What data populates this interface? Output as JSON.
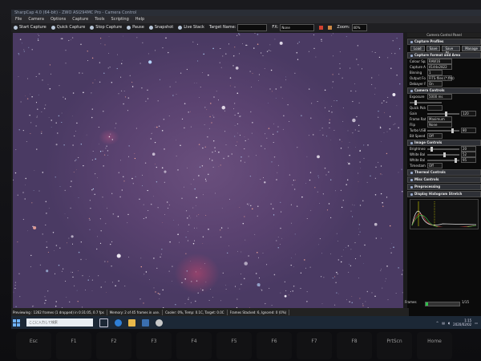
{
  "window": {
    "title": "SharpCap 4.0 (64-bit) - ZWO ASI294MC Pro - Camera Control"
  },
  "menu": [
    "File",
    "Camera",
    "Options",
    "Capture",
    "Tools",
    "Scripting",
    "Help"
  ],
  "toolbar": {
    "start_capture": "Start Capture",
    "quick_capture": "Quick Capture",
    "stop_capture": "Stop Capture",
    "pause": "Pause",
    "snapshot": "Snapshot",
    "live_stack": "Live Stack",
    "target_name_label": "Target Name:",
    "target_name_value": "",
    "fx_label": "FX:",
    "fx_value": "None",
    "zoom_label": "Zoom:",
    "zoom_value": "40%"
  },
  "panel": {
    "title": "Camera Control Panel",
    "capture_profiles": "Capture Profiles",
    "profile_buttons": [
      "Load",
      "Save",
      "Save As",
      "Manage"
    ],
    "capture_format": "Capture Format and Area",
    "colour_space_label": "Colour Space",
    "colour_space_value": "RAW16",
    "capture_area_label": "Capture Area",
    "capture_area_value": "4144x2822",
    "binning_label": "Binning",
    "binning_value": "1",
    "output_format_label": "Output Format",
    "output_format_value": "FITS files (*.fits)",
    "debayer_label": "Debayer Preview",
    "debayer_value": "On",
    "camera_controls": "Camera Controls",
    "exposure_label": "Exposure",
    "exposure_value": "5000 ms",
    "quick_picks_label": "Quick Picks",
    "gain_label": "Gain",
    "gain_value": "120",
    "frame_rate_label": "Frame Rate Limit",
    "frame_rate_value": "Maximum",
    "flip_label": "Flip",
    "flip_value": "None",
    "turbo_label": "Turbo USB",
    "turbo_value": "80",
    "bit_speed_label": "Bit Speed Mode",
    "bit_speed_value": "Off",
    "image_controls": "Image Controls",
    "brightness_label": "Brightness",
    "brightness_value": "20",
    "wb_red_label": "White Bal (R)",
    "wb_red_value": "52",
    "wb_blue_label": "White Bal (B)",
    "wb_blue_value": "95",
    "timestamp_label": "Timestamp Frames",
    "timestamp_value": "Off",
    "thermal": "Thermal Controls",
    "misc": "Misc Controls",
    "preprocessing": "Preprocessing",
    "histogram": "Display Histogram Stretch"
  },
  "status": {
    "previewing": "Previewing : 1262 frames (1 dropped) in 0:31:05, 0.7 fps",
    "memory": "Memory: 2 of 45 frames in use.",
    "cooler": "Cooler: 0%, Temp: 0.1C, Target: 0.0C",
    "stacked": "Frames Stacked: 6, Ignored: 0 (0%)",
    "frames_label": "Frames",
    "progress_text": "1/15",
    "progress_fraction": 0.07
  },
  "taskbar": {
    "search_placeholder": "ここに入力して検索",
    "time": "1:15",
    "date": "2020/02/02"
  },
  "keys": [
    "Esc",
    "F1",
    "F2",
    "F3",
    "F4",
    "F5",
    "F6",
    "F7",
    "F8",
    "PrtScn",
    "Home",
    "End",
    "PgUp"
  ]
}
